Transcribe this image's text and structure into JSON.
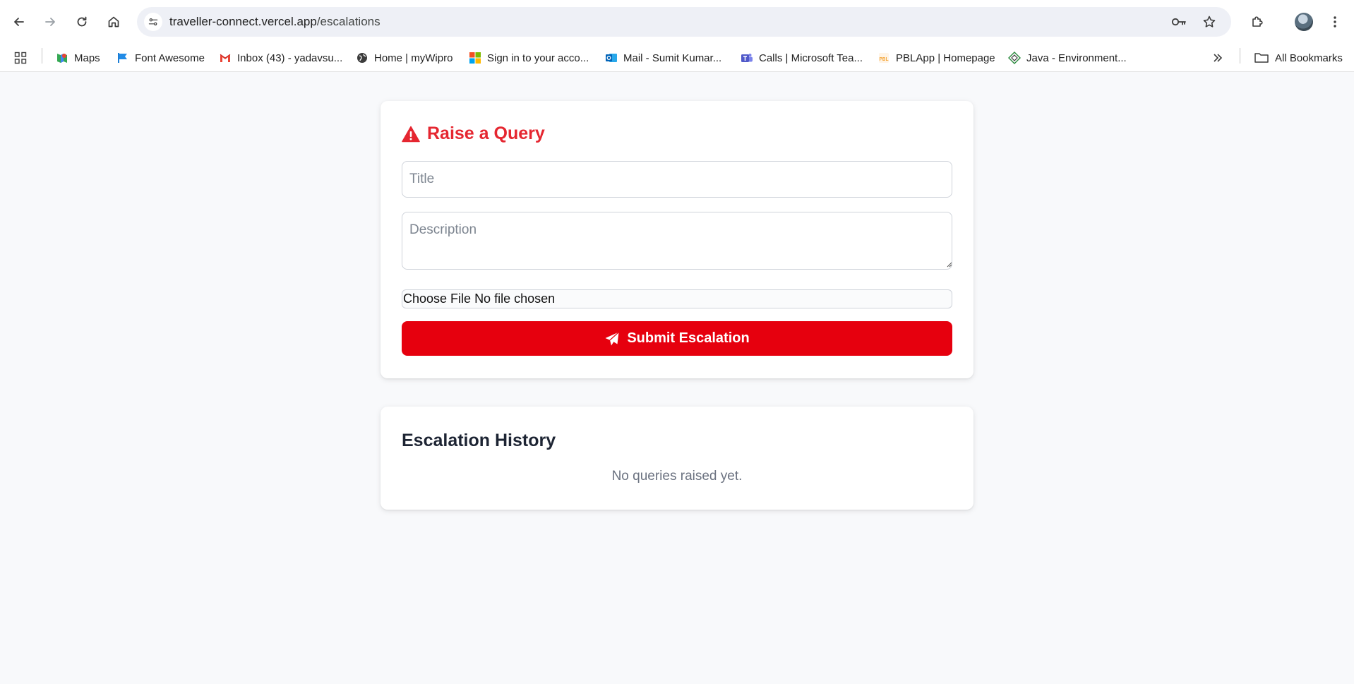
{
  "browser": {
    "url_host": "traveller-connect.vercel.app",
    "url_path": "/escalations",
    "bookmarks": [
      {
        "label": "Maps",
        "icon": "maps-icon"
      },
      {
        "label": "Font Awesome",
        "icon": "flag-icon"
      },
      {
        "label": "Inbox (43) - yadavsu...",
        "icon": "gmail-icon"
      },
      {
        "label": "Home | myWipro",
        "icon": "globe-icon"
      },
      {
        "label": "Sign in to your acco...",
        "icon": "microsoft-icon"
      },
      {
        "label": "Mail - Sumit Kumar...",
        "icon": "outlook-icon"
      },
      {
        "label": "Calls | Microsoft Tea...",
        "icon": "teams-icon"
      },
      {
        "label": "PBLApp | Homepage",
        "icon": "pbl-icon"
      },
      {
        "label": "Java - Environment...",
        "icon": "java-icon"
      }
    ],
    "all_bookmarks_label": "All Bookmarks"
  },
  "query_form": {
    "heading": "Raise a Query",
    "title_placeholder": "Title",
    "description_placeholder": "Description",
    "file_button_label": "Choose File",
    "file_status": "No file chosen",
    "submit_label": "Submit Escalation"
  },
  "history": {
    "heading": "Escalation History",
    "empty_message": "No queries raised yet."
  },
  "colors": {
    "accent": "#e6000e",
    "heading_red": "#e52630",
    "page_background": "#f8f9fb"
  }
}
